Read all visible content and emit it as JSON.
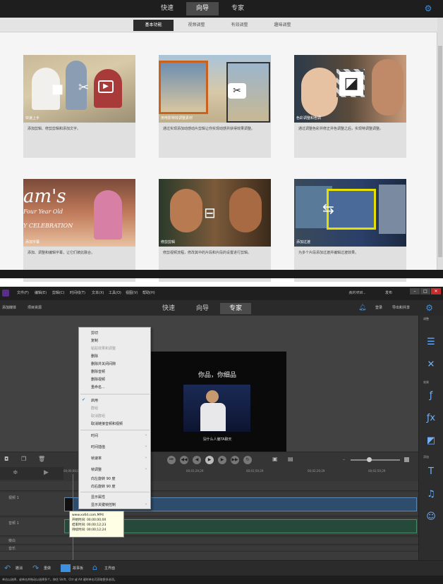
{
  "top": {
    "tabs": [
      "快速",
      "向导",
      "专家"
    ],
    "active_tab": 1,
    "sub_tabs": [
      "基本功能",
      "视频调整",
      "有效调整",
      "趣味调整"
    ],
    "cards": [
      {
        "caption": "快速上手",
        "desc": "添加剪辑、修剪剪辑和添加文字。"
      },
      {
        "caption": "用电影特效调整素材",
        "desc": "通过实现添加动感动片剪辑让你实现动感并获得效果调整。"
      },
      {
        "caption": "色彩调整和色调",
        "desc": "通过调整色彩并修正并色调整之后，实现特调整调整。"
      },
      {
        "caption": "添加字幕",
        "desc": "添加、调整和编辑字幕，让它们彼此融合。"
      },
      {
        "caption": "修剪剪辑",
        "desc": "修剪视频流程，修改其中的片段和片段的设置进行剪辑。"
      },
      {
        "caption": "添加过渡",
        "desc": "为多个片段添加过渡并编辑过渡效果。"
      }
    ]
  },
  "bot": {
    "menu": [
      "文件(F)",
      "编辑(E)",
      "剪辑(C)",
      "时间线(T)",
      "文本(X)",
      "工具(O)",
      "视图(V)",
      "帮助(H)"
    ],
    "project_status": "我的项目...",
    "publish": "发布",
    "tabs": [
      "快速",
      "向导",
      "专家"
    ],
    "active_tab": 2,
    "toolbar_left": [
      "添加媒体",
      "项目资源"
    ],
    "account": "登录",
    "share": "导出和共享",
    "video": {
      "title": "你品，你细品",
      "subtitle": "没什么人偏TA聊天"
    },
    "context_menu": [
      {
        "label": "剪切"
      },
      {
        "label": "复制"
      },
      {
        "label": "粘贴效果和调整",
        "disabled": true
      },
      {
        "label": "删除"
      },
      {
        "label": "删除并关闭间隙"
      },
      {
        "label": "删除音频"
      },
      {
        "label": "删除视频"
      },
      {
        "label": "重命名..."
      },
      {
        "label": "启用",
        "checked": true
      },
      {
        "label": "群组",
        "disabled": true
      },
      {
        "label": "取消群组",
        "disabled": true
      },
      {
        "label": "取消链接音频和视频"
      },
      {
        "label": "时间",
        "submenu": true
      },
      {
        "label": "时间插值",
        "submenu": true
      },
      {
        "label": "帧速率",
        "submenu": true
      },
      {
        "label": "帧调整",
        "submenu": true
      },
      {
        "label": "向左旋转 90 度"
      },
      {
        "label": "向右旋转 90 度"
      },
      {
        "label": "显示属性"
      },
      {
        "label": "显示关键帧控制",
        "submenu": true
      }
    ],
    "timecodes": [
      "00;00;00;00",
      "00;00;59;29",
      "00;01;29;29",
      "00;01;59;29",
      "00;02;29;29",
      "00;02;59;29",
      "00;03;29;29"
    ],
    "tracks": [
      "视频 1",
      "音频 1",
      "旁白",
      "音乐"
    ],
    "tooltip": [
      "www.xx6d.com.MP4",
      "开始时间: 00;00;00;00",
      "结束时间: 00;00;12;23",
      "持续时间: 00;00;12;24"
    ],
    "right_panel_labels": [
      "调整",
      "效果",
      "添加"
    ],
    "bottom": [
      "撤消",
      "重做",
      "故事板",
      "主界面"
    ],
    "status_text": "单击以选择，或单击并拖动以选择多个。按住 Shift、Ctrl 或 Alt 键时单击可获取更多选项。"
  },
  "colors": {
    "accent": "#3d8fe0",
    "playhead": "#e04040"
  }
}
